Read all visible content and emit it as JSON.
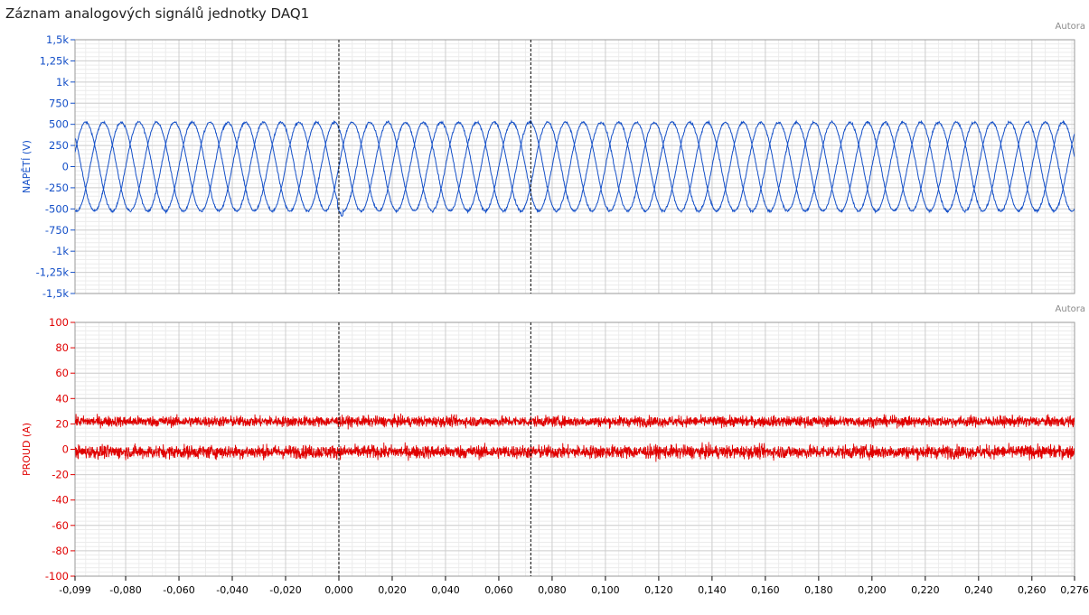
{
  "window": {
    "title": "Záznam analogových signálů jednotky DAQ1"
  },
  "panels": {
    "top_button": "Autora",
    "bottom_button": "Autora"
  },
  "colors": {
    "voltage": "#1550c8",
    "current": "#e00000",
    "grid_major": "#cfcfcf",
    "grid_minor": "#ececec",
    "cursor": "#000000"
  },
  "chart_data": [
    {
      "type": "line",
      "ylabel": "NAPĚTÍ (V)",
      "ylim": [
        -1500,
        1500
      ],
      "yticks": [
        1500,
        1250,
        1000,
        750,
        500,
        250,
        0,
        -250,
        -500,
        -750,
        -1000,
        -1250,
        -1500
      ],
      "ytick_labels": [
        "1,5k",
        "1,25k",
        "1k",
        "750",
        "500",
        "250",
        "0",
        "-250",
        "-500",
        "-750",
        "-1k",
        "-1,25k",
        "-1,5k"
      ],
      "xlim": [
        -0.099,
        0.276
      ],
      "series_model": "three-phase sine, amplitude ~525 V, period 0.02 s (50 Hz), phases 0°, -120°, +120°, small noise",
      "series": [
        {
          "amplitude": 525,
          "frequency_hz": 50,
          "phase_deg": 0
        },
        {
          "amplitude": 525,
          "frequency_hz": 50,
          "phase_deg": -120
        },
        {
          "amplitude": 525,
          "frequency_hz": 50,
          "phase_deg": 120
        }
      ],
      "cursors_x": [
        0.0,
        0.072
      ],
      "grid": true
    },
    {
      "type": "line",
      "ylabel": "PROUD (A)",
      "ylim": [
        -100,
        100
      ],
      "yticks": [
        100,
        80,
        60,
        40,
        20,
        0,
        -20,
        -40,
        -60,
        -80,
        -100
      ],
      "ytick_labels": [
        "100",
        "80",
        "60",
        "40",
        "20",
        "0",
        "-20",
        "-40",
        "-60",
        "-80",
        "-100"
      ],
      "xlim": [
        -0.099,
        0.276
      ],
      "xticks": [
        -0.099,
        -0.08,
        -0.06,
        -0.04,
        -0.02,
        0.0,
        0.02,
        0.04,
        0.06,
        0.08,
        0.1,
        0.12,
        0.14,
        0.16,
        0.18,
        0.2,
        0.22,
        0.24,
        0.26,
        0.276
      ],
      "xtick_labels": [
        "-0,099",
        "-0,080",
        "-0,060",
        "-0,040",
        "-0,020",
        "0,000",
        "0,020",
        "0,040",
        "0,060",
        "0,080",
        "0,100",
        "0,120",
        "0,140",
        "0,160",
        "0,180",
        "0,200",
        "0,220",
        "0,240",
        "0,260",
        "0,276"
      ],
      "series": [
        {
          "mean": 22,
          "noise_band": 4
        },
        {
          "mean": -2,
          "noise_band": 5
        }
      ],
      "cursors_x": [
        0.0,
        0.072
      ],
      "grid": true
    }
  ]
}
